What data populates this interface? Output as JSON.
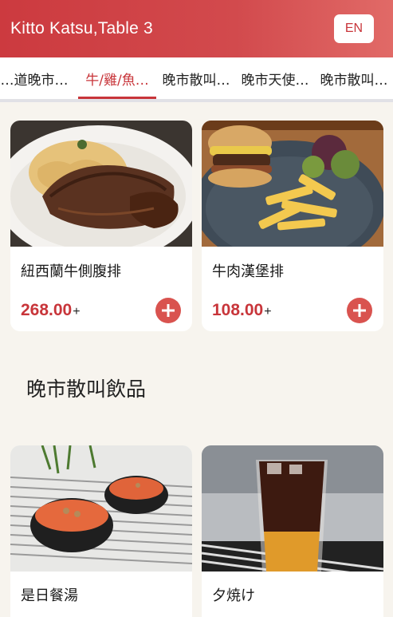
{
  "header": {
    "title": "Kitto Katsu,Table 3",
    "lang_button": "EN"
  },
  "tabs": [
    {
      "label": "…道晚市…"
    },
    {
      "label": "牛/雞/魚…"
    },
    {
      "label": "晚市散叫…"
    },
    {
      "label": "晚市天使…"
    },
    {
      "label": "晚市散叫…"
    }
  ],
  "active_tab_index": 1,
  "colors": {
    "accent": "#c8353a",
    "add_button": "#d9534f",
    "background": "#f7f4ee"
  },
  "menu": {
    "items": [
      {
        "name": "紐西蘭牛側腹排",
        "price": "268.00",
        "price_suffix": "+",
        "image": "steak-pasta-photo"
      },
      {
        "name": "牛肉漢堡排",
        "price": "108.00",
        "price_suffix": "+",
        "image": "burger-fries-photo"
      }
    ],
    "section": {
      "title": "晚市散叫飲品",
      "items": [
        {
          "name": "是日餐湯",
          "image": "soup-bowls-photo"
        },
        {
          "name": "夕焼け",
          "image": "iced-drink-photo"
        }
      ]
    }
  },
  "icons": {
    "add": "plus-circle-icon"
  }
}
